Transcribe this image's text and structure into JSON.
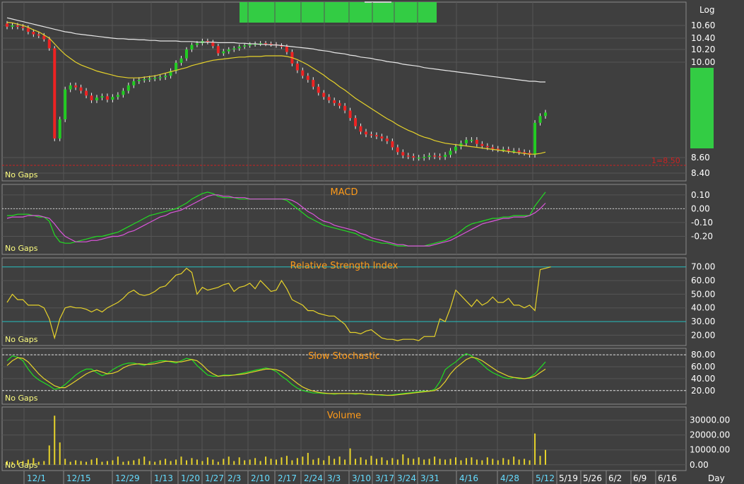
{
  "scale_label": "Log",
  "period_label": "Day",
  "no_gaps_label": "No Gaps",
  "support_label": "1=8.50",
  "colors": {
    "background": "#3f3f3f",
    "grid": "#555555",
    "up": "#22cc22",
    "down": "#ee2222",
    "ma_long": "#e8e8e8",
    "ma_short": "#e6d22a",
    "macd": "#22dd22",
    "signal": "#dd55dd",
    "rsi": "#e6d22a",
    "stoch_k": "#22dd22",
    "stoch_d": "#e6d22a",
    "volume": "#e6d22a",
    "support": "#cc2222",
    "date_text": "#66ddff",
    "title_text": "#ff9b1a"
  },
  "x_axis": {
    "labels": [
      "12/1",
      "12/15",
      "12/29",
      "1/13",
      "1/20",
      "1/27",
      "2/3",
      "2/10",
      "2/17",
      "2/24",
      "3/3",
      "3/10",
      "3/17",
      "3/24",
      "3/31",
      "4/16",
      "4/28",
      "5/12"
    ],
    "future_labels": [
      "5/19",
      "5/26",
      "6/2",
      "6/9",
      "6/16"
    ]
  },
  "chart_data": [
    {
      "type": "candlestick",
      "title": "",
      "scale": "log",
      "ylim": [
        8.35,
        10.85
      ],
      "y_ticks": [
        "10.60",
        "10.40",
        "10.20",
        "10.00",
        "8.60",
        "8.40"
      ],
      "support_line": 8.5,
      "closes": [
        10.58,
        10.6,
        10.58,
        10.56,
        10.5,
        10.46,
        10.44,
        10.38,
        10.22,
        8.88,
        9.16,
        9.6,
        9.66,
        9.63,
        9.58,
        9.51,
        9.44,
        9.48,
        9.5,
        9.45,
        9.49,
        9.52,
        9.58,
        9.66,
        9.72,
        9.74,
        9.75,
        9.76,
        9.77,
        9.78,
        9.8,
        9.87,
        9.99,
        10.06,
        10.2,
        10.28,
        10.31,
        10.35,
        10.33,
        10.26,
        10.14,
        10.17,
        10.2,
        10.22,
        10.25,
        10.27,
        10.29,
        10.3,
        10.31,
        10.3,
        10.29,
        10.27,
        10.25,
        10.16,
        9.98,
        9.88,
        9.8,
        9.74,
        9.64,
        9.55,
        9.49,
        9.44,
        9.4,
        9.36,
        9.29,
        9.18,
        9.06,
        8.98,
        8.94,
        8.93,
        8.91,
        8.88,
        8.84,
        8.75,
        8.68,
        8.63,
        8.62,
        8.6,
        8.6,
        8.61,
        8.63,
        8.62,
        8.61,
        8.64,
        8.7,
        8.76,
        8.81,
        8.86,
        8.86,
        8.8,
        8.77,
        8.75,
        8.73,
        8.72,
        8.72,
        8.7,
        8.7,
        8.68,
        8.67,
        8.64,
        9.11,
        9.21,
        9.26
      ],
      "ma_long": [
        10.72,
        10.7,
        10.68,
        10.66,
        10.64,
        10.62,
        10.6,
        10.58,
        10.56,
        10.54,
        10.52,
        10.5,
        10.49,
        10.47,
        10.46,
        10.45,
        10.44,
        10.43,
        10.42,
        10.41,
        10.4,
        10.39,
        10.39,
        10.38,
        10.38,
        10.37,
        10.37,
        10.36,
        10.36,
        10.35,
        10.35,
        10.35,
        10.35,
        10.34,
        10.34,
        10.34,
        10.33,
        10.33,
        10.33,
        10.33,
        10.32,
        10.32,
        10.32,
        10.32,
        10.31,
        10.31,
        10.3,
        10.3,
        10.29,
        10.29,
        10.28,
        10.28,
        10.27,
        10.26,
        10.25,
        10.24,
        10.23,
        10.22,
        10.21,
        10.19,
        10.18,
        10.17,
        10.15,
        10.14,
        10.13,
        10.11,
        10.1,
        10.08,
        10.07,
        10.06,
        10.04,
        10.03,
        10.01,
        10.0,
        9.99,
        9.97,
        9.96,
        9.95,
        9.94,
        9.92,
        9.91,
        9.9,
        9.89,
        9.88,
        9.87,
        9.86,
        9.85,
        9.84,
        9.83,
        9.82,
        9.81,
        9.8,
        9.79,
        9.78,
        9.77,
        9.76,
        9.75,
        9.74,
        9.73,
        9.72,
        9.72,
        9.71,
        9.71
      ],
      "ma_short": [
        10.65,
        10.64,
        10.62,
        10.6,
        10.57,
        10.53,
        10.5,
        10.45,
        10.4,
        10.3,
        10.2,
        10.12,
        10.06,
        10.0,
        9.96,
        9.93,
        9.9,
        9.87,
        9.85,
        9.83,
        9.81,
        9.79,
        9.78,
        9.77,
        9.77,
        9.77,
        9.78,
        9.79,
        9.8,
        9.82,
        9.84,
        9.86,
        9.88,
        9.9,
        9.92,
        9.95,
        9.97,
        9.99,
        10.01,
        10.03,
        10.04,
        10.05,
        10.06,
        10.07,
        10.08,
        10.08,
        10.09,
        10.09,
        10.09,
        10.1,
        10.1,
        10.1,
        10.1,
        10.09,
        10.07,
        10.04,
        10.0,
        9.96,
        9.91,
        9.86,
        9.81,
        9.75,
        9.7,
        9.64,
        9.59,
        9.53,
        9.47,
        9.42,
        9.37,
        9.32,
        9.27,
        9.22,
        9.17,
        9.13,
        9.08,
        9.04,
        9.0,
        8.97,
        8.93,
        8.9,
        8.88,
        8.85,
        8.83,
        8.81,
        8.8,
        8.79,
        8.78,
        8.77,
        8.76,
        8.75,
        8.74,
        8.73,
        8.72,
        8.71,
        8.7,
        8.69,
        8.68,
        8.67,
        8.66,
        8.65,
        8.65,
        8.66,
        8.68
      ]
    },
    {
      "type": "line",
      "title": "MACD",
      "ylim": [
        -0.3,
        0.14
      ],
      "y_ticks": [
        "0.10",
        "0.00",
        "-0.10",
        "-0.20"
      ],
      "series": [
        {
          "name": "macd",
          "values": [
            -0.05,
            -0.05,
            -0.04,
            -0.04,
            -0.04,
            -0.05,
            -0.06,
            -0.06,
            -0.09,
            -0.19,
            -0.24,
            -0.25,
            -0.25,
            -0.24,
            -0.23,
            -0.22,
            -0.21,
            -0.2,
            -0.2,
            -0.19,
            -0.18,
            -0.17,
            -0.15,
            -0.13,
            -0.11,
            -0.09,
            -0.07,
            -0.05,
            -0.04,
            -0.03,
            -0.02,
            -0.01,
            0.0,
            0.02,
            0.04,
            0.07,
            0.09,
            0.11,
            0.12,
            0.11,
            0.09,
            0.08,
            0.08,
            0.08,
            0.07,
            0.07,
            0.07,
            0.07,
            0.07,
            0.07,
            0.07,
            0.07,
            0.07,
            0.06,
            0.03,
            0.0,
            -0.03,
            -0.06,
            -0.08,
            -0.1,
            -0.12,
            -0.13,
            -0.14,
            -0.15,
            -0.16,
            -0.17,
            -0.18,
            -0.2,
            -0.22,
            -0.23,
            -0.24,
            -0.25,
            -0.25,
            -0.26,
            -0.27,
            -0.27,
            -0.27,
            -0.27,
            -0.27,
            -0.27,
            -0.26,
            -0.25,
            -0.24,
            -0.23,
            -0.21,
            -0.19,
            -0.16,
            -0.13,
            -0.11,
            -0.1,
            -0.09,
            -0.08,
            -0.07,
            -0.07,
            -0.06,
            -0.06,
            -0.05,
            -0.05,
            -0.05,
            -0.05,
            0.02,
            0.07,
            0.12
          ]
        },
        {
          "name": "signal",
          "values": [
            -0.07,
            -0.06,
            -0.06,
            -0.06,
            -0.05,
            -0.05,
            -0.05,
            -0.06,
            -0.07,
            -0.11,
            -0.16,
            -0.2,
            -0.22,
            -0.24,
            -0.24,
            -0.24,
            -0.23,
            -0.23,
            -0.22,
            -0.21,
            -0.2,
            -0.2,
            -0.19,
            -0.17,
            -0.16,
            -0.14,
            -0.12,
            -0.1,
            -0.08,
            -0.06,
            -0.05,
            -0.03,
            -0.02,
            -0.01,
            0.01,
            0.03,
            0.05,
            0.07,
            0.09,
            0.1,
            0.1,
            0.09,
            0.09,
            0.08,
            0.08,
            0.08,
            0.07,
            0.07,
            0.07,
            0.07,
            0.07,
            0.07,
            0.07,
            0.07,
            0.06,
            0.04,
            0.01,
            -0.02,
            -0.04,
            -0.07,
            -0.09,
            -0.1,
            -0.12,
            -0.13,
            -0.14,
            -0.15,
            -0.16,
            -0.18,
            -0.19,
            -0.21,
            -0.22,
            -0.23,
            -0.24,
            -0.25,
            -0.26,
            -0.26,
            -0.27,
            -0.27,
            -0.27,
            -0.27,
            -0.27,
            -0.26,
            -0.25,
            -0.24,
            -0.23,
            -0.21,
            -0.19,
            -0.17,
            -0.15,
            -0.13,
            -0.11,
            -0.1,
            -0.09,
            -0.08,
            -0.07,
            -0.07,
            -0.06,
            -0.06,
            -0.06,
            -0.05,
            -0.03,
            0.0,
            0.04
          ]
        }
      ]
    },
    {
      "type": "line",
      "title": "Relative Strength Index",
      "ylim": [
        14,
        74
      ],
      "y_ticks": [
        "70.00",
        "60.00",
        "50.00",
        "40.00",
        "30.00",
        "20.00"
      ],
      "reference_lines": [
        70,
        30
      ],
      "series": [
        {
          "name": "rsi",
          "values": [
            44,
            50,
            46,
            46,
            42,
            42,
            42,
            40,
            32,
            18,
            32,
            40,
            41,
            40,
            40,
            39,
            37,
            39,
            37,
            40,
            42,
            44,
            47,
            51,
            53,
            50,
            49,
            50,
            52,
            55,
            56,
            60,
            64,
            65,
            69,
            66,
            50,
            55,
            53,
            54,
            55,
            57,
            58,
            52,
            55,
            56,
            58,
            54,
            60,
            56,
            52,
            53,
            60,
            54,
            46,
            44,
            42,
            38,
            38,
            36,
            35,
            34,
            34,
            31,
            28,
            22,
            22,
            21,
            23,
            24,
            21,
            18,
            17,
            17,
            16,
            17,
            17,
            17,
            16,
            19,
            19,
            19,
            32,
            30,
            40,
            53,
            49,
            45,
            41,
            46,
            42,
            44,
            48,
            44,
            44,
            47,
            42,
            42,
            40,
            42,
            38,
            68,
            69,
            70
          ]
        }
      ]
    },
    {
      "type": "line",
      "title": "Slow Stochastic",
      "ylim": [
        2,
        86
      ],
      "y_ticks": [
        "80.00",
        "60.00",
        "40.00",
        "20.00"
      ],
      "reference_lines": [
        80,
        20
      ],
      "series": [
        {
          "name": "k",
          "values": [
            70,
            78,
            76,
            70,
            56,
            45,
            38,
            33,
            28,
            22,
            24,
            30,
            38,
            46,
            52,
            56,
            56,
            50,
            45,
            48,
            55,
            60,
            64,
            66,
            66,
            64,
            62,
            66,
            68,
            70,
            70,
            68,
            66,
            70,
            74,
            72,
            62,
            54,
            46,
            44,
            44,
            46,
            46,
            46,
            48,
            50,
            52,
            54,
            56,
            58,
            56,
            52,
            44,
            38,
            30,
            24,
            20,
            18,
            16,
            16,
            15,
            15,
            14,
            15,
            15,
            15,
            14,
            15,
            14,
            13,
            13,
            12,
            12,
            13,
            14,
            15,
            16,
            17,
            18,
            19,
            19,
            22,
            35,
            55,
            62,
            68,
            76,
            82,
            78,
            72,
            64,
            56,
            50,
            46,
            42,
            40,
            42,
            40,
            40,
            42,
            48,
            58,
            68
          ]
        },
        {
          "name": "d",
          "values": [
            62,
            70,
            75,
            74,
            68,
            58,
            48,
            40,
            34,
            28,
            25,
            25,
            30,
            36,
            42,
            48,
            52,
            54,
            51,
            48,
            49,
            52,
            58,
            62,
            64,
            65,
            64,
            64,
            65,
            67,
            69,
            69,
            68,
            68,
            70,
            72,
            70,
            63,
            54,
            48,
            44,
            45,
            45,
            46,
            47,
            48,
            50,
            52,
            54,
            56,
            56,
            55,
            52,
            46,
            39,
            32,
            26,
            22,
            19,
            17,
            16,
            15,
            15,
            15,
            15,
            15,
            15,
            15,
            14,
            14,
            13,
            13,
            12,
            12,
            13,
            14,
            15,
            16,
            17,
            18,
            19,
            20,
            25,
            35,
            48,
            58,
            65,
            72,
            76,
            74,
            70,
            64,
            58,
            52,
            48,
            44,
            42,
            41,
            40,
            41,
            44,
            50,
            56
          ]
        }
      ]
    },
    {
      "type": "bar",
      "title": "Volume",
      "ylim": [
        -2000,
        36000
      ],
      "y_ticks": [
        "30000.00",
        "20000.00",
        "10000.00",
        "0.00"
      ],
      "values": [
        2500,
        2000,
        3000,
        2500,
        3500,
        4500,
        2000,
        2500,
        13000,
        33000,
        15000,
        4000,
        2000,
        3000,
        2500,
        2000,
        3500,
        4500,
        2000,
        2500,
        3000,
        5500,
        2000,
        2500,
        3000,
        4000,
        5500,
        2500,
        2000,
        3000,
        4000,
        2500,
        3500,
        5500,
        3000,
        4500,
        3500,
        2500,
        5000,
        3500,
        2000,
        4000,
        5500,
        2500,
        5000,
        3000,
        3500,
        4500,
        2500,
        5500,
        4000,
        3500,
        5000,
        6000,
        3000,
        4500,
        5500,
        8000,
        3500,
        4500,
        3000,
        6000,
        4000,
        5500,
        3500,
        11000,
        4000,
        5000,
        3500,
        6000,
        4000,
        5000,
        3000,
        4500,
        3500,
        7000,
        4500,
        4000,
        5000,
        3500,
        4000,
        5500,
        4000,
        3500,
        4000,
        5000,
        3000,
        4500,
        5000,
        3500,
        3000,
        5000,
        4000,
        3000,
        4500,
        3500,
        5500,
        3500,
        4000,
        3000,
        21000,
        6000,
        10000
      ]
    }
  ]
}
